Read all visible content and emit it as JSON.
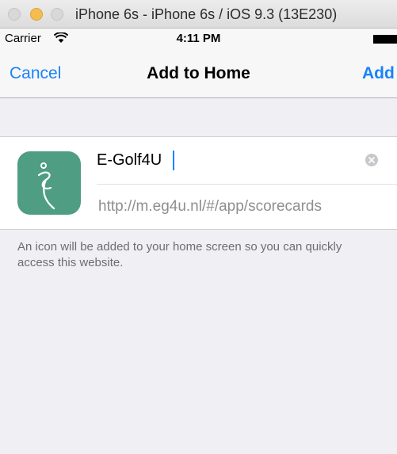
{
  "window": {
    "title": "iPhone 6s - iPhone 6s / iOS 9.3 (13E230)"
  },
  "status_bar": {
    "carrier": "Carrier",
    "time": "4:11 PM"
  },
  "nav": {
    "cancel_label": "Cancel",
    "title": "Add to Home",
    "add_label": "Add"
  },
  "form": {
    "name_value": "E-Golf4U",
    "url": "http://m.eg4u.nl/#/app/scorecards"
  },
  "explanation": "An icon will be added to your home screen so you can quickly access this website.",
  "icons": {
    "wifi": "wifi-icon",
    "battery": "battery-icon",
    "app": "golfer-logo-icon",
    "clear": "clear-icon"
  },
  "colors": {
    "accent": "#1a82fb",
    "app_icon_bg": "#4f9e84",
    "background": "#efeff4"
  }
}
